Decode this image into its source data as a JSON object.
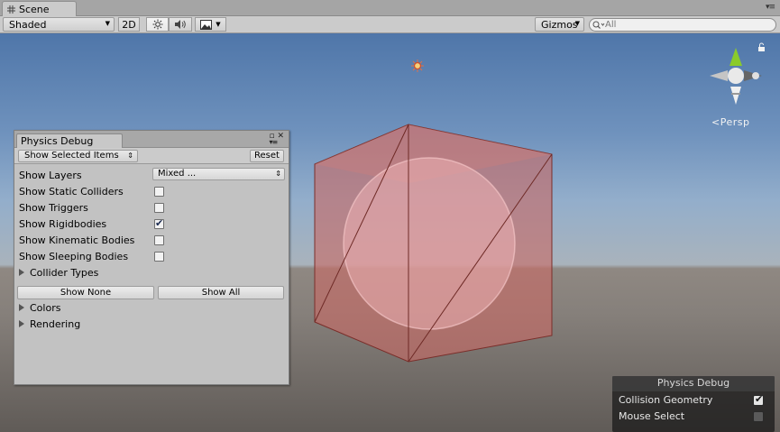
{
  "window": {
    "tab_title": "Scene",
    "menu_glyph": "▾≡"
  },
  "toolbar": {
    "shading_mode": "Shaded",
    "mode_2d": "2D",
    "gizmos_label": "Gizmos",
    "search_placeholder": "All",
    "icons": [
      "sun-icon",
      "audio-icon",
      "image-effects-icon"
    ]
  },
  "scene": {
    "view_label": "Persp",
    "colors": {
      "sky_top": "#4f76a9",
      "horizon": "#a9b3bc",
      "ground": "#86807b",
      "collider_fill": "#c86a66"
    }
  },
  "physics_debug": {
    "title": "Physics Debug",
    "filter_dropdown": "Show Selected Items",
    "reset_label": "Reset",
    "layers": {
      "label": "Show Layers",
      "value": "Mixed ..."
    },
    "options": [
      {
        "label": "Show Static Colliders",
        "checked": false
      },
      {
        "label": "Show Triggers",
        "checked": false
      },
      {
        "label": "Show Rigidbodies",
        "checked": true
      },
      {
        "label": "Show Kinematic Bodies",
        "checked": false
      },
      {
        "label": "Show Sleeping Bodies",
        "checked": false
      }
    ],
    "collider_types_label": "Collider Types",
    "show_none_label": "Show None",
    "show_all_label": "Show All",
    "colors_label": "Colors",
    "rendering_label": "Rendering"
  },
  "overlay": {
    "title": "Physics Debug",
    "options": [
      {
        "label": "Collision Geometry",
        "checked": true
      },
      {
        "label": "Mouse Select",
        "checked": false
      }
    ]
  }
}
